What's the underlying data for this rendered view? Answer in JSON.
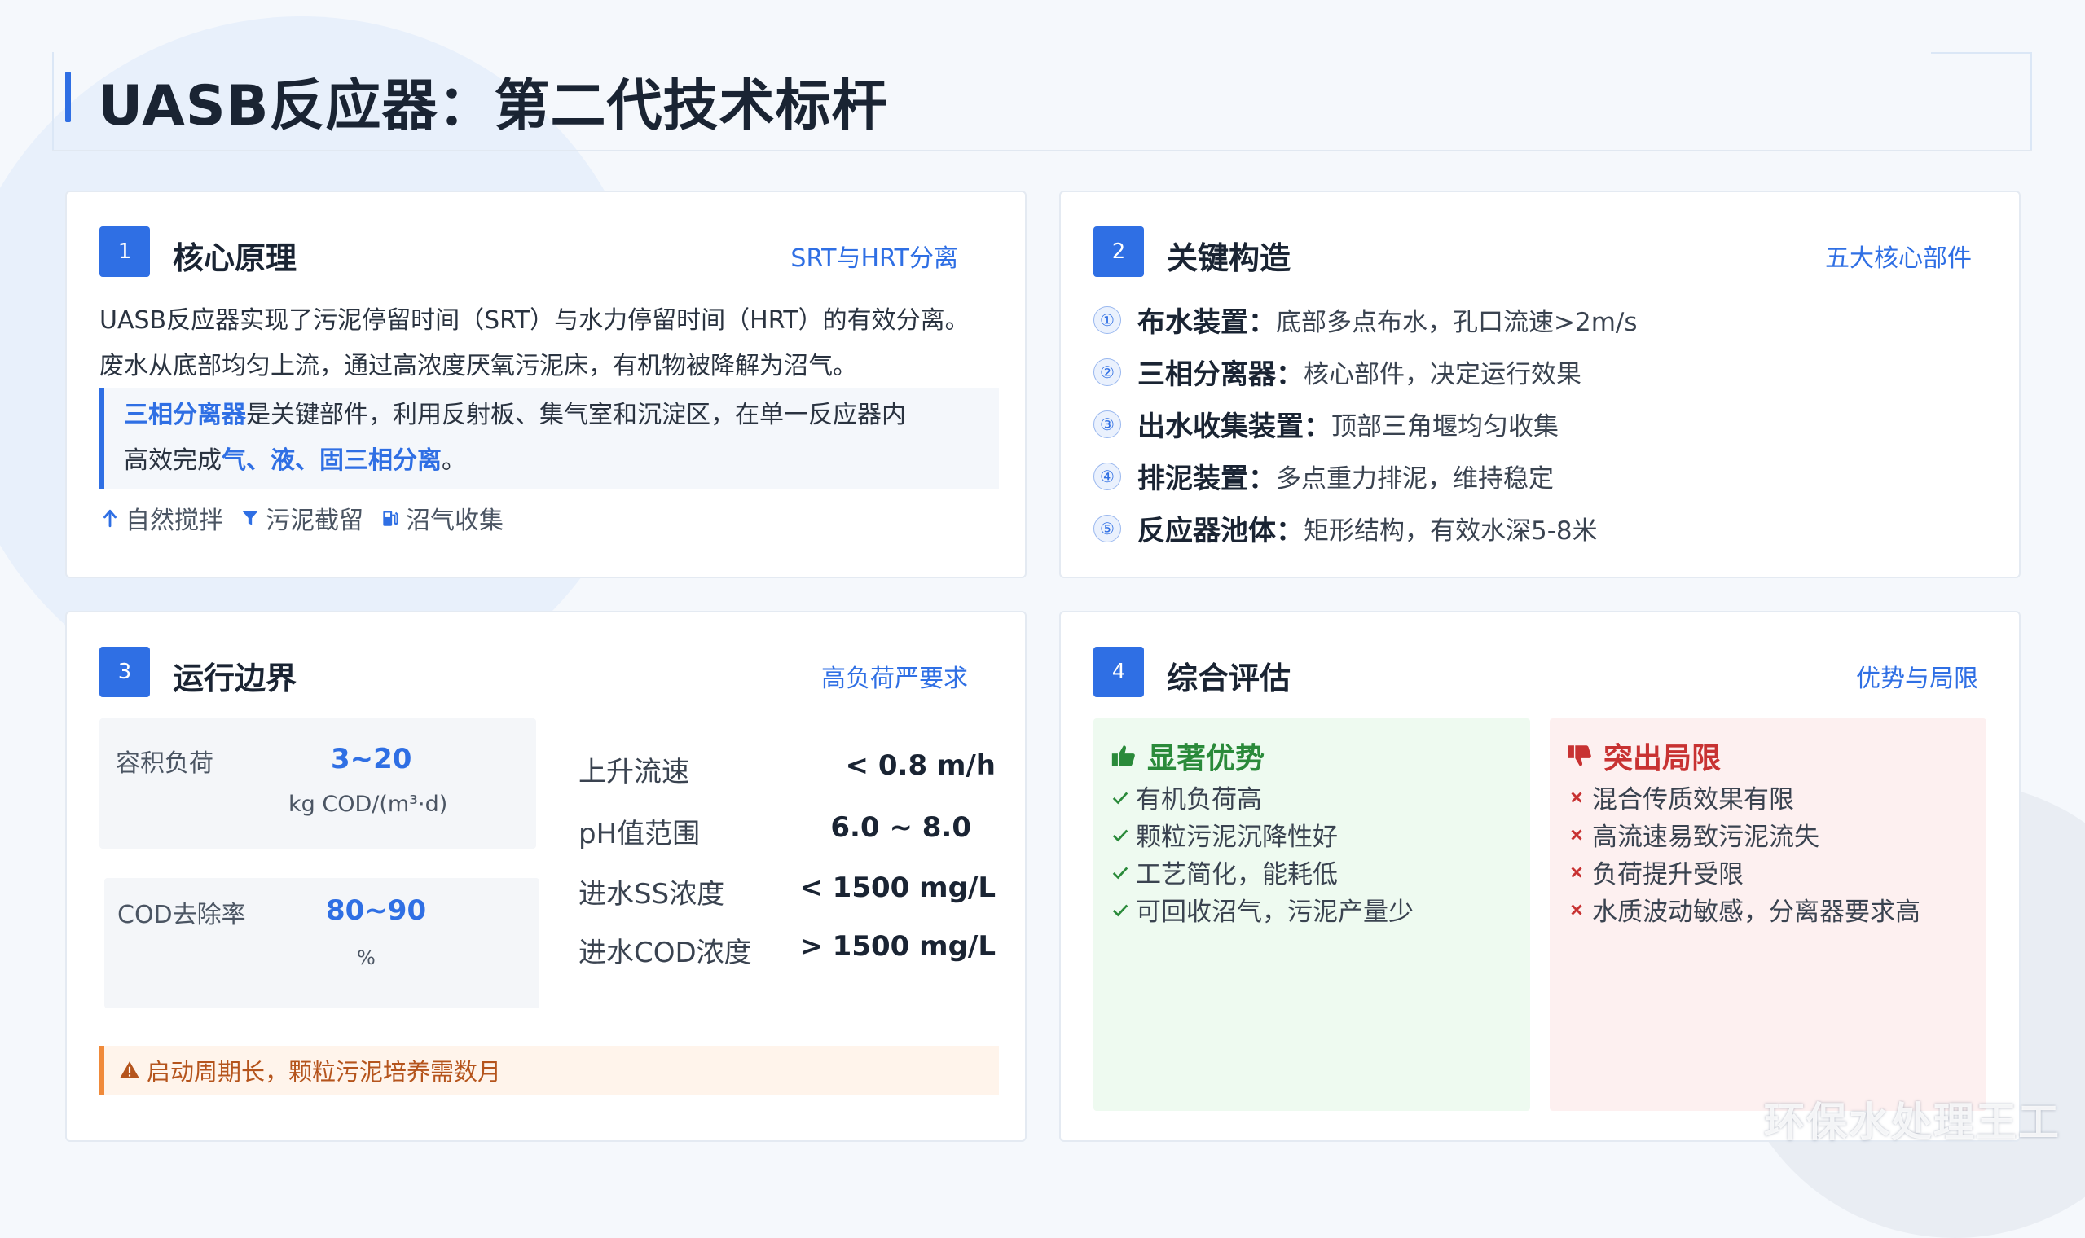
{
  "title": "UASB反应器：第二代技术标杆",
  "colors": {
    "accent": "#2f6fe4",
    "success": "#2a8a3a",
    "danger": "#c83232",
    "warning": "#f08a3a"
  },
  "card1": {
    "num": "1",
    "title": "核心原理",
    "tag": "SRT与HRT分离",
    "para_line1": "UASB反应器实现了污泥停留时间（SRT）与水力停留时间（HRT）的有效分离。",
    "para_line2": "废水从底部均匀上流，通过高浓度厌氧污泥床，有机物被降解为沼气。",
    "quote_hl1": "三相分离器",
    "quote_mid1": "是关键部件，利用反射板、集气室和沉淀区，在单一反应器内",
    "quote_mid2": "高效完成",
    "quote_hl2": "气、液、固三相分离",
    "quote_end": "。",
    "features": [
      {
        "icon": "arrow-up-icon",
        "label": "自然搅拌"
      },
      {
        "icon": "filter-icon",
        "label": "污泥截留"
      },
      {
        "icon": "gas-pump-icon",
        "label": "沼气收集"
      }
    ]
  },
  "card2": {
    "num": "2",
    "title": "关键构造",
    "tag": "五大核心部件",
    "items": [
      {
        "marker": "①",
        "label": "布水装置：",
        "desc": "底部多点布水，孔口流速>2m/s"
      },
      {
        "marker": "②",
        "label": "三相分离器：",
        "desc": "核心部件，决定运行效果"
      },
      {
        "marker": "③",
        "label": "出水收集装置：",
        "desc": "顶部三角堰均匀收集"
      },
      {
        "marker": "④",
        "label": "排泥装置：",
        "desc": "多点重力排泥，维持稳定"
      },
      {
        "marker": "⑤",
        "label": "反应器池体：",
        "desc": "矩形结构，有效水深5-8米"
      }
    ]
  },
  "card3": {
    "num": "3",
    "title": "运行边界",
    "tag": "高负荷严要求",
    "metrics": [
      {
        "label": "容积负荷",
        "value": "3~20",
        "unit": "kg COD/(m³·d)"
      },
      {
        "label": "COD去除率",
        "value": "80~90",
        "unit": "%"
      }
    ],
    "params": [
      {
        "name": "上升流速",
        "value": "< 0.8 m/h"
      },
      {
        "name": "pH值范围",
        "value": "6.0 ~ 8.0"
      },
      {
        "name": "进水SS浓度",
        "value": "< 1500 mg/L"
      },
      {
        "name": "进水COD浓度",
        "value": "> 1500 mg/L"
      }
    ],
    "warning": "启动周期长，颗粒污泥培养需数月"
  },
  "card4": {
    "num": "4",
    "title": "综合评估",
    "tag": "优势与局限",
    "pros_title": "显著优势",
    "pros": [
      "有机负荷高",
      "颗粒污泥沉降性好",
      "工艺简化，能耗低",
      "可回收沼气，污泥产量少"
    ],
    "cons_title": "突出局限",
    "cons": [
      "混合传质效果有限",
      "高流速易致污泥流失",
      "负荷提升受限",
      "水质波动敏感，分离器要求高"
    ]
  },
  "watermark": "环保水处理王工"
}
